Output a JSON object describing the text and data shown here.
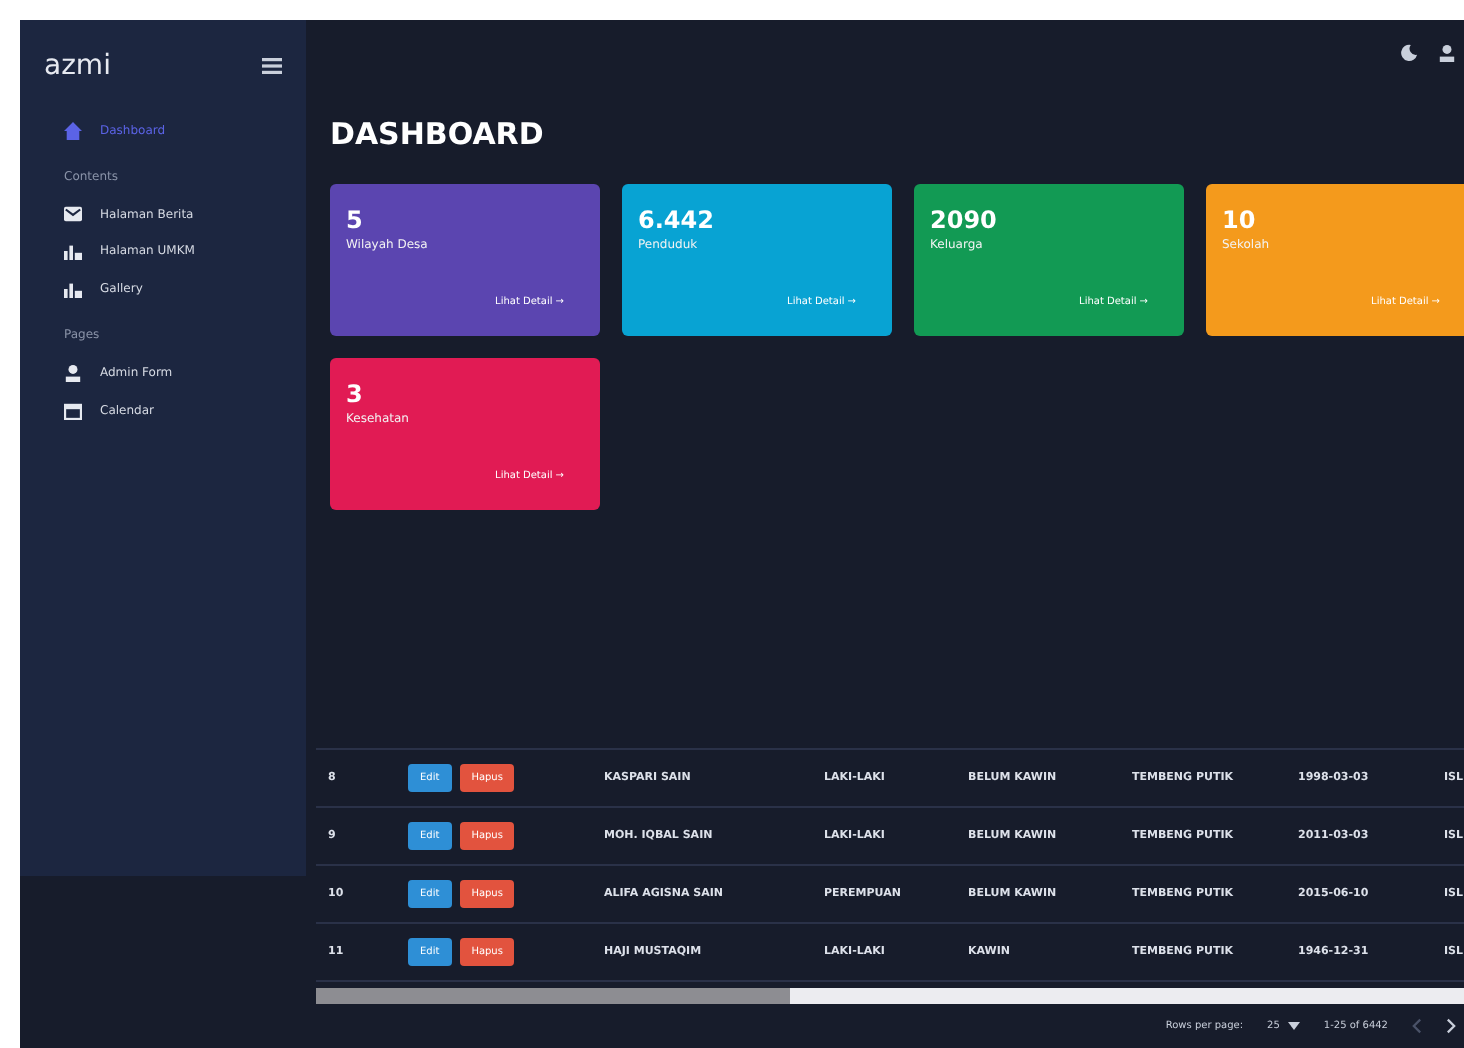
{
  "brand": "azmi",
  "sidebar": {
    "items": [
      {
        "kind": "link",
        "label": "Dashboard",
        "selected": true
      },
      {
        "kind": "heading",
        "label": "Contents"
      },
      {
        "kind": "link",
        "label": "Halaman Berita",
        "selected": false
      },
      {
        "kind": "link",
        "label": "Halaman UMKM",
        "selected": false
      },
      {
        "kind": "link",
        "label": "Gallery",
        "selected": false
      },
      {
        "kind": "heading",
        "label": "Pages"
      },
      {
        "kind": "link",
        "label": "Admin Form",
        "selected": false
      },
      {
        "kind": "link",
        "label": "Calendar",
        "selected": false
      }
    ]
  },
  "page_title": "DASHBOARD",
  "cards": [
    {
      "value": "5",
      "label": "Wilayah Desa",
      "link": "Lihat Detail →",
      "color": "#5b45b0"
    },
    {
      "value": "6.442",
      "label": "Penduduk",
      "link": "Lihat Detail →",
      "color": "#08a3d3"
    },
    {
      "value": "2090",
      "label": "Keluarga",
      "link": "Lihat Detail →",
      "color": "#129a54"
    },
    {
      "value": "10",
      "label": "Sekolah",
      "link": "Lihat Detail →",
      "color": "#f49a1c"
    },
    {
      "value": "3",
      "label": "Kesehatan",
      "link": "Lihat Detail →",
      "color": "#e11b54"
    }
  ],
  "table": {
    "rows": [
      {
        "actions": [
          "Edit",
          "Hapus"
        ],
        "cells": [
          "8",
          "KASPARI SAIN",
          "LAKI-LAKI",
          "BELUM KAWIN",
          "TEMBENG PUTIK",
          "1998-03-03",
          "ISL"
        ]
      },
      {
        "actions": [
          "Edit",
          "Hapus"
        ],
        "cells": [
          "9",
          "MOH. IQBAL SAIN",
          "LAKI-LAKI",
          "BELUM KAWIN",
          "TEMBENG PUTIK",
          "2011-03-03",
          "ISL"
        ]
      },
      {
        "actions": [
          "Edit",
          "Hapus"
        ],
        "cells": [
          "10",
          "ALIFA AGISNA SAIN",
          "PEREMPUAN",
          "BELUM KAWIN",
          "TEMBENG PUTIK",
          "2015-06-10",
          "ISL"
        ]
      },
      {
        "actions": [
          "Edit",
          "Hapus"
        ],
        "cells": [
          "11",
          "HAJI MUSTAQIM",
          "LAKI-LAKI",
          "KAWIN",
          "TEMBENG PUTIK",
          "1946-12-31",
          "ISL"
        ]
      }
    ]
  },
  "footer": {
    "rows_label": "Rows per page:",
    "rows_value": "25",
    "range": "1-25 of 6442"
  }
}
